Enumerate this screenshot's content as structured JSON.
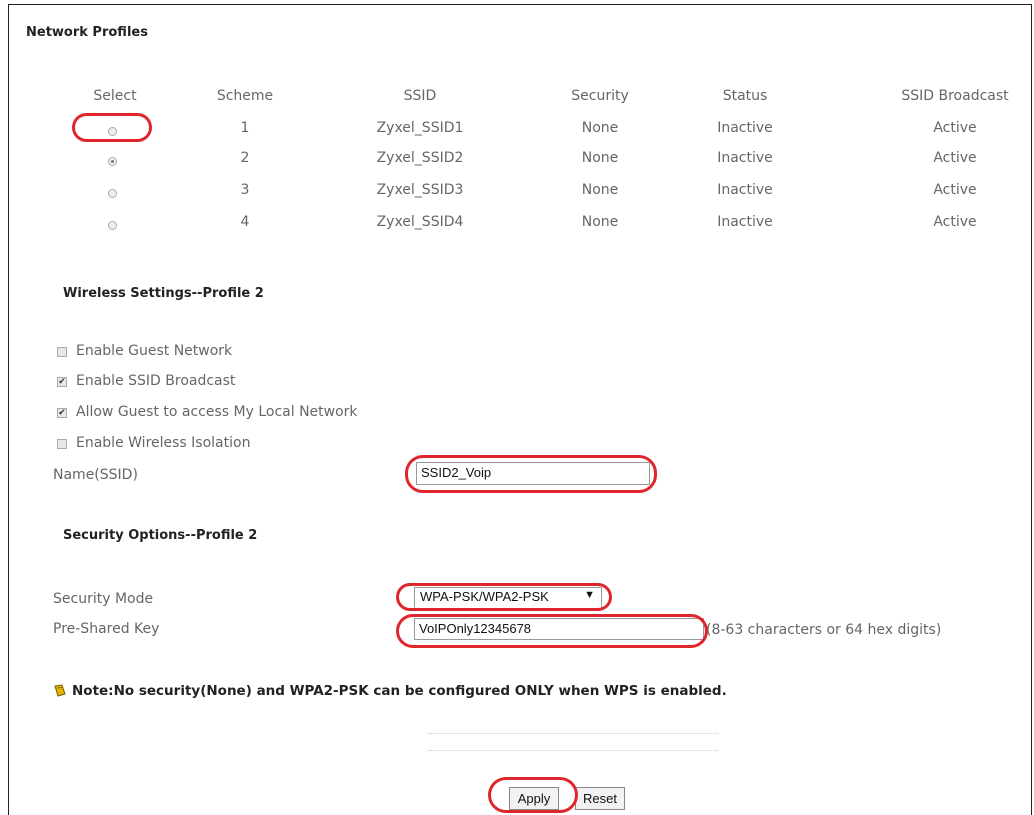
{
  "network_profiles": {
    "title": "Network Profiles",
    "headers": [
      "Select",
      "Scheme",
      "SSID",
      "Security",
      "Status",
      "SSID Broadcast"
    ],
    "rows": [
      {
        "scheme": "1",
        "ssid": "Zyxel_SSID1",
        "security": "None",
        "status": "Inactive",
        "broadcast": "Active",
        "selected": false
      },
      {
        "scheme": "2",
        "ssid": "Zyxel_SSID2",
        "security": "None",
        "status": "Inactive",
        "broadcast": "Active",
        "selected": true
      },
      {
        "scheme": "3",
        "ssid": "Zyxel_SSID3",
        "security": "None",
        "status": "Inactive",
        "broadcast": "Active",
        "selected": false
      },
      {
        "scheme": "4",
        "ssid": "Zyxel_SSID4",
        "security": "None",
        "status": "Inactive",
        "broadcast": "Active",
        "selected": false
      }
    ]
  },
  "wireless_settings": {
    "title": "Wireless Settings--Profile 2",
    "options": [
      {
        "label": "Enable Guest Network",
        "checked": false
      },
      {
        "label": "Enable SSID Broadcast",
        "checked": true
      },
      {
        "label": "Allow Guest to access My Local Network",
        "checked": true
      },
      {
        "label": "Enable Wireless Isolation",
        "checked": false
      }
    ],
    "name_label": "Name(SSID)",
    "name_value": "SSID2_Voip"
  },
  "security_options": {
    "title": "Security Options--Profile 2",
    "mode_label": "Security Mode",
    "mode_value": "WPA-PSK/WPA2-PSK",
    "psk_label": "Pre-Shared Key",
    "psk_value": "VoIPOnly12345678",
    "psk_hint": "(8-63 characters or 64 hex digits)"
  },
  "note": "Note:No security(None) and WPA2-PSK can be configured ONLY when WPS is enabled.",
  "buttons": {
    "apply": "Apply",
    "reset": "Reset"
  },
  "colors": {
    "highlight": "#e0262d",
    "note_icon": "#e2b500"
  },
  "icons": {
    "note": "note-icon"
  }
}
